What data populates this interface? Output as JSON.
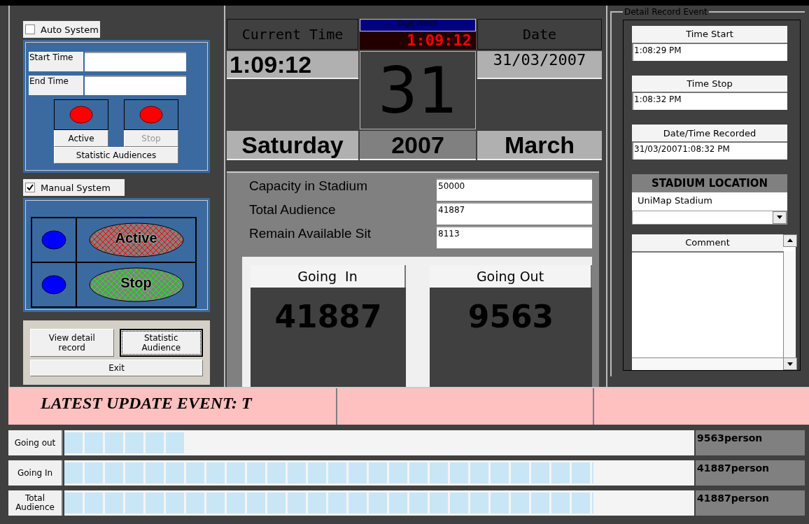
{
  "auto_system": {
    "label": "Auto System",
    "checked": false,
    "start_label": "Start Time",
    "end_label": "End Time",
    "lamps": [
      {
        "label": "Active",
        "disabled": false
      },
      {
        "label": "Stop",
        "disabled": true
      }
    ],
    "statistic_button": "Statistic Audiences"
  },
  "manual_system": {
    "label": "Manual System",
    "checked": true,
    "rows": [
      {
        "label": "Active",
        "color": "#ff0000"
      },
      {
        "label": "Stop",
        "color": "#00ff00"
      }
    ]
  },
  "actions": {
    "view": "View detail record",
    "statistic": "Statistic Audience",
    "exit": "Exit"
  },
  "clock": {
    "current_time_label": "Current Time",
    "watch_title": "Digit Watch",
    "watch_reading": "1:09:12",
    "date_label": "Date",
    "time": "1:09:12",
    "date": "31/03/2007",
    "day": "31",
    "weekday": "Saturday",
    "year": "2007",
    "month": "March"
  },
  "stadium": [
    {
      "label": "Capacity in Stadium",
      "value": "50000"
    },
    {
      "label": "Total Audience",
      "value": "41887"
    },
    {
      "label": "Remain Available Sit",
      "value": "8113"
    }
  ],
  "counters": [
    {
      "label": "Going  In",
      "value": "41887"
    },
    {
      "label": "Going Out",
      "value": "9563"
    }
  ],
  "detail": {
    "title": "Detail Record Event",
    "fields": [
      {
        "label": "Time Start",
        "value": "1:08:29 PM"
      },
      {
        "label": "Time Stop",
        "value": "1:08:32 PM"
      },
      {
        "label": "Date/Time Recorded",
        "value": "31/03/20071:08:32 PM"
      }
    ],
    "location_title": "STADIUM LOCATION",
    "location": "UniMap Stadium",
    "comment_label": "Comment"
  },
  "event_banner": "LATEST UPDATE EVENT: T",
  "stats": [
    {
      "label": "Going out",
      "level": 0.19,
      "reading": "9563person"
    },
    {
      "label": "Going In",
      "level": 0.84,
      "reading": "41887person"
    },
    {
      "label": "Total Audience",
      "level": 0.84,
      "reading": "41887person"
    }
  ]
}
